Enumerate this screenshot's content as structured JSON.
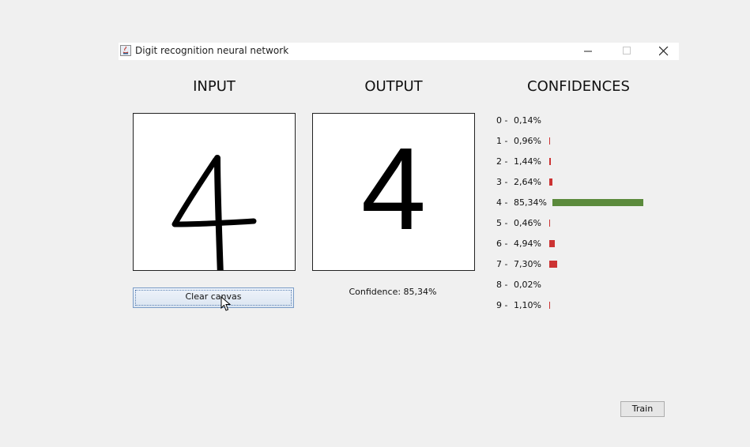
{
  "window": {
    "title": "Digit recognition neural network"
  },
  "headings": {
    "input": "INPUT",
    "output": "OUTPUT",
    "confidences": "CONFIDENCES"
  },
  "output": {
    "digit": "4",
    "confidence_label": "Confidence: 85,34%"
  },
  "buttons": {
    "clear": "Clear canvas",
    "train": "Train"
  },
  "colors": {
    "top_bar": "#5b8a3c",
    "other_bar": "#cc3333"
  },
  "confidences": [
    {
      "digit": "0 -",
      "value": "0,14%",
      "pct": 0.14
    },
    {
      "digit": "1 -",
      "value": "0,96%",
      "pct": 0.96
    },
    {
      "digit": "2 -",
      "value": "1,44%",
      "pct": 1.44
    },
    {
      "digit": "3 -",
      "value": "2,64%",
      "pct": 2.64
    },
    {
      "digit": "4 -",
      "value": "85,34%",
      "pct": 85.34
    },
    {
      "digit": "5 -",
      "value": "0,46%",
      "pct": 0.46
    },
    {
      "digit": "6 -",
      "value": "4,94%",
      "pct": 4.94
    },
    {
      "digit": "7 -",
      "value": "7,30%",
      "pct": 7.3
    },
    {
      "digit": "8 -",
      "value": "0,02%",
      "pct": 0.02
    },
    {
      "digit": "9 -",
      "value": "1,10%",
      "pct": 1.1
    }
  ]
}
